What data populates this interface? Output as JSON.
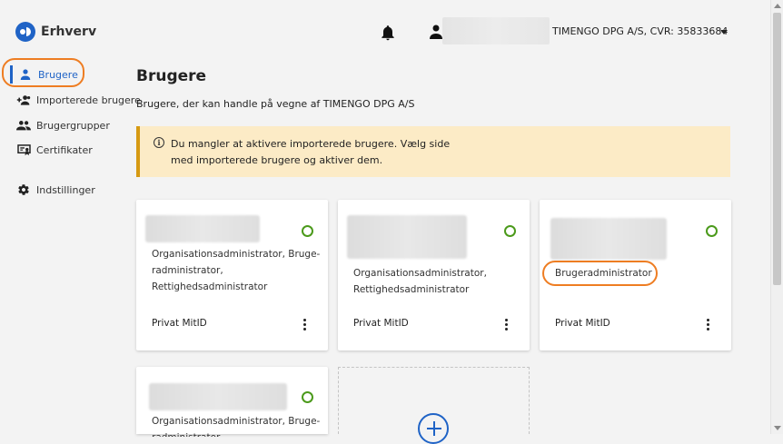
{
  "header": {
    "app_name": "Erhverv",
    "org_name": "TIMENGO DPG A/S, CVR: 35833684"
  },
  "sidebar": {
    "items": [
      {
        "label": "Brugere",
        "icon": "person-icon",
        "active": true
      },
      {
        "label": "Importerede brugere",
        "icon": "person-add-icon"
      },
      {
        "label": "Brugergrupper",
        "icon": "group-icon"
      },
      {
        "label": "Certifikater",
        "icon": "certificate-icon"
      },
      {
        "label": "Indstillinger",
        "icon": "gear-icon"
      }
    ]
  },
  "main": {
    "title": "Brugere",
    "subtitle": "Brugere, der kan handle på vegne af TIMENGO DPG A/S",
    "notice": {
      "line1": "Du mangler at aktivere importerede brugere. Vælg side",
      "line2": "med importerede brugere og aktiver dem."
    },
    "cards": [
      {
        "roles": [
          "Organisationsadministrator, Bruge-",
          "radministrator,",
          "Rettighedsadministrator"
        ],
        "method": "Privat MitID"
      },
      {
        "roles": [
          "Organisationsadministrator,",
          "Rettighedsadministrator"
        ],
        "method": "Privat MitID"
      },
      {
        "roles": [
          "Brugeradministrator"
        ],
        "method": "Privat MitID"
      },
      {
        "roles": [
          "Organisationsadministrator, Bruge-",
          "radministrator,"
        ]
      }
    ]
  },
  "colors": {
    "accent": "#1f63c6",
    "status_active": "#4b9a1b",
    "notice_bg": "#fcebc6",
    "notice_border": "#d69a12",
    "highlight": "#ee7d22"
  }
}
